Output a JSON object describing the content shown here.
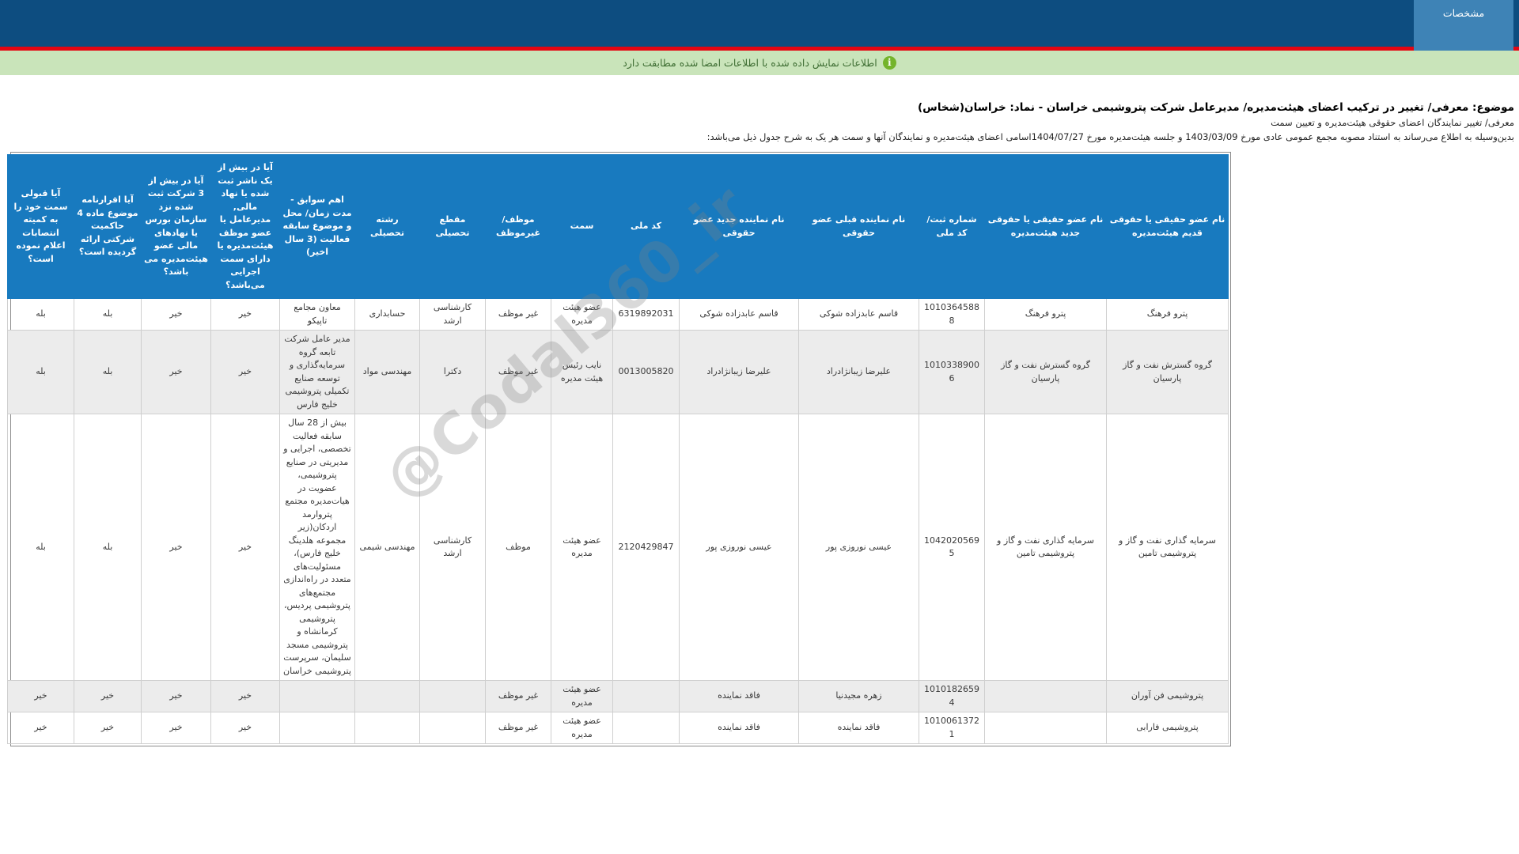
{
  "topbar": {
    "tab_label": "مشخصات"
  },
  "banner": {
    "message": "اطلاعات نمایش داده شده با اطلاعات امضا شده مطابقت دارد",
    "icon": "info-icon",
    "icon_glyph": "i"
  },
  "intro": {
    "subject": "موضوع: معرفی/ تغییر در ترکیب اعضای هیئت‌مدیره/ مدیرعامل شرکت پتروشیمی خراسان - نماد: خراسان(شخاس)",
    "line2": "معرفی/ تغییر نمایندگان اعضای حقوقی هیئت‌مدیره و تعیین سمت",
    "line3": "بدین‌وسیله به اطلاع می‌رساند به استناد مصوبه مجمع عمومی عادی مورخ  1403/03/09  و جلسه هیئت‌مدیره مورخ 1404/07/27اسامی اعضای هیئت‌مدیره و نمایندگان آنها و سمت هر یک به شرح جدول ذیل می‌باشد:"
  },
  "table": {
    "columns": [
      "نام عضو حقیقی یا حقوقی قدیم هیئت‌مدیره",
      "نام عضو حقیقی یا حقوقی جدید هیئت‌مدیره",
      "شماره ثبت/ کد ملی",
      "نام نماینده قبلی عضو حقوقی",
      "نام نماینده جدید عضو حقوقی",
      "کد ملی",
      "سمت",
      "موظف/ غیرموظف",
      "مقطع تحصیلی",
      "رشته تحصیلی",
      "اهم سوابق - مدت زمان/ محل و موضوع سابقه فعالیت (3 سال اخیر)",
      "آیا در بیش از یک ناشر ثبت شده یا نهاد مالی, مدیرعامل یا عضو موظف هیئت‌مدیره یا دارای سمت اجرایی می‌باشد؟",
      "آیا در بیش از 3 شرکت ثبت شده نزد سازمان بورس یا نهادهای مالی عضو هیئت‌مدیره می باشد؟",
      "آیا اقرارنامه موضوع ماده 4 حاکمیت شرکتی ارائه گردیده است؟",
      "آیا قبولی سمت خود را به کمیته انتصابات اعلام نموده است؟"
    ],
    "rows": [
      [
        "پترو فرهنگ",
        "پترو فرهنگ",
        "10103645888",
        "قاسم عابدزاده شوکی",
        "قاسم عابدزاده شوکی",
        "6319892031",
        "عضو هیئت مدیره",
        "غیر موظف",
        "کارشناسی ارشد",
        "حسابداری",
        "معاون مجامع تاپیکو",
        "خیر",
        "خیر",
        "بله",
        "بله"
      ],
      [
        "گروه گسترش نفت و گاز پارسیان",
        "گروه گسترش نفت و گاز پارسیان",
        "10103389006",
        "علیرضا زیبانژادراد",
        "علیرضا زیبانژادراد",
        "0013005820",
        "نایب رئیس هیئت مدیره",
        "غیر موظف",
        "دکترا",
        "مهندسی مواد",
        "مدیر عامل شرکت تابعه گروه سرمایه‌گذاری و توسعه صنایع تکمیلی پتروشیمی خلیج فارس",
        "خیر",
        "خیر",
        "بله",
        "بله"
      ],
      [
        "سرمایه گذاری نفت و گاز و پتروشیمی تامین",
        "سرمایه گذاری نفت و گاز و پتروشیمی تامین",
        "10420205695",
        "عیسی نوروزی پور",
        "عیسی نوروزی پور",
        "2120429847",
        "عضو هیئت مدیره",
        "موظف",
        "کارشناسی ارشد",
        "مهندسی شیمی",
        "بیش از 28 سال سابقه فعالیت تخصصی، اجرایی و مدیریتی در صنایع پتروشیمی، عضویت در هیات‌مدیره مجتمع پتروارمد اردکان(زیر مجموعه هلدینگ خلیج فارس)، مسئولیت‌های متعدد در راه‌اندازی مجتمع‌های پتروشیمی پردیس، پتروشیمی کرمانشاه و پتروشیمی مسجد سلیمان، سرپرست پتروشیمی خراسان",
        "خیر",
        "خیر",
        "بله",
        "بله"
      ],
      [
        "پتروشیمی فن آوران",
        "",
        "10101826594",
        "زهره مجیدنیا",
        "فاقد نماینده",
        "",
        "عضو هیئت مدیره",
        "غیر موظف",
        "",
        "",
        "",
        "خیر",
        "خیر",
        "خیر",
        "خیر"
      ],
      [
        "پتروشیمی فارابی",
        "",
        "10100613721",
        "فاقد نماینده",
        "فاقد نماینده",
        "",
        "عضو هیئت مدیره",
        "غیر موظف",
        "",
        "",
        "",
        "خیر",
        "خیر",
        "خیر",
        "خیر"
      ]
    ]
  },
  "watermark": "@Codal360_ir",
  "colors": {
    "topbar_navy": "#0d4d80",
    "tab_blue": "#3e83b6",
    "alert_red": "#e30613",
    "banner_green_bg": "#c9e4ba",
    "banner_green_text": "#3f6e34",
    "icon_green": "#74b42c",
    "table_header_blue": "#187abf",
    "row_stripe_gray": "#ececec"
  }
}
